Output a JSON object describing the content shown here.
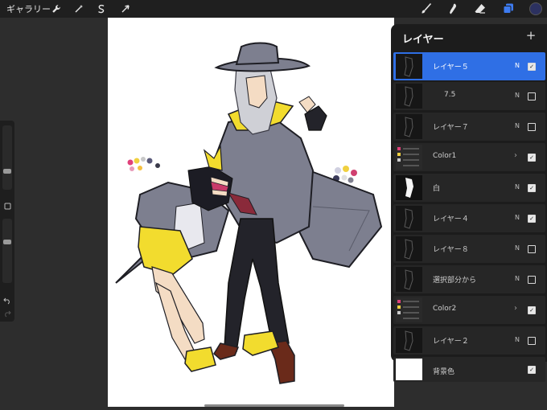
{
  "toolbar": {
    "gallery_label": "ギャラリー",
    "left_tools": [
      "wrench-icon",
      "magic-wand-icon",
      "selection-icon",
      "transform-icon"
    ],
    "right_tools": [
      "brush-icon",
      "smudge-icon",
      "eraser-icon",
      "layers-icon"
    ],
    "active_color": "#2c3160"
  },
  "layers_panel": {
    "title": "レイヤー",
    "layers": [
      {
        "name": "レイヤー５",
        "mode": "N",
        "visible": true,
        "selected": true,
        "group": false,
        "indent": false
      },
      {
        "name": "7.5",
        "mode": "N",
        "visible": false,
        "selected": false,
        "group": false,
        "indent": true
      },
      {
        "name": "レイヤー７",
        "mode": "N",
        "visible": false,
        "selected": false,
        "group": false,
        "indent": false
      },
      {
        "name": "Color1",
        "mode": "",
        "visible": true,
        "selected": false,
        "group": true,
        "indent": false
      },
      {
        "name": "白",
        "mode": "N",
        "visible": true,
        "selected": false,
        "group": false,
        "indent": false
      },
      {
        "name": "レイヤー４",
        "mode": "N",
        "visible": true,
        "selected": false,
        "group": false,
        "indent": false
      },
      {
        "name": "レイヤー８",
        "mode": "N",
        "visible": false,
        "selected": false,
        "group": false,
        "indent": false
      },
      {
        "name": "選択部分から",
        "mode": "N",
        "visible": false,
        "selected": false,
        "group": false,
        "indent": false
      },
      {
        "name": "Color2",
        "mode": "",
        "visible": true,
        "selected": false,
        "group": true,
        "indent": false
      },
      {
        "name": "レイヤー２",
        "mode": "N",
        "visible": false,
        "selected": false,
        "group": false,
        "indent": false
      },
      {
        "name": "背景色",
        "mode": "",
        "visible": true,
        "selected": false,
        "group": false,
        "indent": false
      }
    ]
  },
  "palette": {
    "swatches_left": [
      "#e0407a",
      "#f0d040",
      "#c8c8c8",
      "#5a5a7a",
      "#e89ab8",
      "#f5c040",
      "#3a3a4a"
    ],
    "swatches_right": [
      "#d0d0e0",
      "#f0d040",
      "#d04070",
      "#3a3a5a",
      "#e0e0e0",
      "#808090"
    ]
  },
  "colors": {
    "coat": "#7d7f8f",
    "yellow": "#f2dc2e",
    "dark": "#23232a",
    "skin": "#f4dcc4",
    "accent": "#c93a6a",
    "boots": "#6a2a1a"
  }
}
